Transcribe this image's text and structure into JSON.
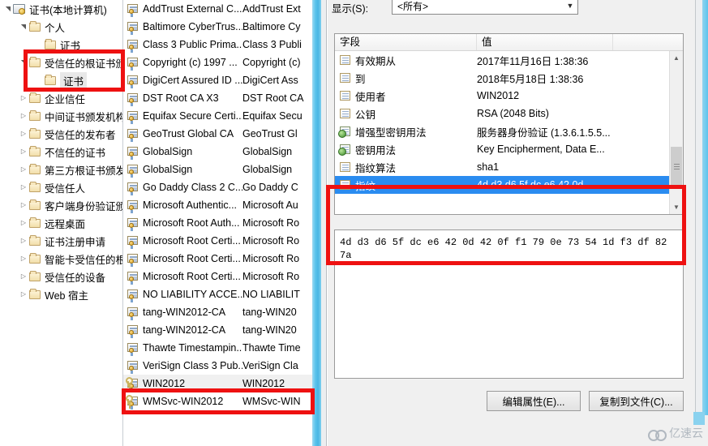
{
  "tree": {
    "items": [
      {
        "label": "证书(本地计算机)",
        "indent": 0,
        "twisty": "open",
        "icon": "console-root-icon"
      },
      {
        "label": "个人",
        "indent": 1,
        "twisty": "open",
        "icon": "folder-icon"
      },
      {
        "label": "证书",
        "indent": 2,
        "twisty": "none",
        "icon": "folder-icon"
      },
      {
        "label": "受信任的根证书颁发机构",
        "indent": 1,
        "twisty": "open",
        "icon": "folder-icon"
      },
      {
        "label": "证书",
        "indent": 2,
        "twisty": "none",
        "icon": "folder-icon",
        "selected": true
      },
      {
        "label": "企业信任",
        "indent": 1,
        "twisty": "closed",
        "icon": "folder-icon"
      },
      {
        "label": "中间证书颁发机构",
        "indent": 1,
        "twisty": "closed",
        "icon": "folder-icon"
      },
      {
        "label": "受信任的发布者",
        "indent": 1,
        "twisty": "closed",
        "icon": "folder-icon"
      },
      {
        "label": "不信任的证书",
        "indent": 1,
        "twisty": "closed",
        "icon": "folder-icon"
      },
      {
        "label": "第三方根证书颁发机构",
        "indent": 1,
        "twisty": "closed",
        "icon": "folder-icon"
      },
      {
        "label": "受信任人",
        "indent": 1,
        "twisty": "closed",
        "icon": "folder-icon"
      },
      {
        "label": "客户端身份验证颁发者",
        "indent": 1,
        "twisty": "closed",
        "icon": "folder-icon"
      },
      {
        "label": "远程桌面",
        "indent": 1,
        "twisty": "closed",
        "icon": "folder-icon"
      },
      {
        "label": "证书注册申请",
        "indent": 1,
        "twisty": "closed",
        "icon": "folder-icon"
      },
      {
        "label": "智能卡受信任的根",
        "indent": 1,
        "twisty": "closed",
        "icon": "folder-icon"
      },
      {
        "label": "受信任的设备",
        "indent": 1,
        "twisty": "closed",
        "icon": "folder-icon"
      },
      {
        "label": "Web 宿主",
        "indent": 1,
        "twisty": "closed",
        "icon": "folder-icon"
      }
    ]
  },
  "cert_list": {
    "rows": [
      {
        "col1": "AddTrust External C...",
        "col2": "AddTrust Ext",
        "icon": "certificate-icon"
      },
      {
        "col1": "Baltimore CyberTrus...",
        "col2": "Baltimore Cy",
        "icon": "certificate-icon"
      },
      {
        "col1": "Class 3 Public Prima...",
        "col2": "Class 3 Publi",
        "icon": "certificate-icon"
      },
      {
        "col1": "Copyright (c) 1997 ...",
        "col2": "Copyright (c)",
        "icon": "certificate-icon"
      },
      {
        "col1": "DigiCert Assured ID ...",
        "col2": "DigiCert Ass",
        "icon": "certificate-icon"
      },
      {
        "col1": "DST Root CA X3",
        "col2": "DST Root CA",
        "icon": "certificate-icon"
      },
      {
        "col1": "Equifax Secure Certi...",
        "col2": "Equifax Secu",
        "icon": "certificate-icon"
      },
      {
        "col1": "GeoTrust Global CA",
        "col2": "GeoTrust Gl",
        "icon": "certificate-icon"
      },
      {
        "col1": "GlobalSign",
        "col2": "GlobalSign",
        "icon": "certificate-icon"
      },
      {
        "col1": "GlobalSign",
        "col2": "GlobalSign",
        "icon": "certificate-icon"
      },
      {
        "col1": "Go Daddy Class 2 C...",
        "col2": "Go Daddy C",
        "icon": "certificate-icon"
      },
      {
        "col1": "Microsoft Authentic...",
        "col2": "Microsoft Au",
        "icon": "certificate-icon"
      },
      {
        "col1": "Microsoft Root Auth...",
        "col2": "Microsoft Ro",
        "icon": "certificate-icon"
      },
      {
        "col1": "Microsoft Root Certi...",
        "col2": "Microsoft Ro",
        "icon": "certificate-icon"
      },
      {
        "col1": "Microsoft Root Certi...",
        "col2": "Microsoft Ro",
        "icon": "certificate-icon"
      },
      {
        "col1": "Microsoft Root Certi...",
        "col2": "Microsoft Ro",
        "icon": "certificate-icon"
      },
      {
        "col1": "NO LIABILITY ACCE...",
        "col2": "NO LIABILIT",
        "icon": "certificate-icon"
      },
      {
        "col1": "tang-WIN2012-CA",
        "col2": "tang-WIN20",
        "icon": "certificate-icon"
      },
      {
        "col1": "tang-WIN2012-CA",
        "col2": "tang-WIN20",
        "icon": "certificate-icon"
      },
      {
        "col1": "Thawte Timestampin...",
        "col2": "Thawte Time",
        "icon": "certificate-icon"
      },
      {
        "col1": "VeriSign Class 3 Pub...",
        "col2": "VeriSign Cla",
        "icon": "certificate-icon"
      },
      {
        "col1": "WIN2012",
        "col2": "WIN2012",
        "icon": "certificate-key-icon",
        "selected": true
      },
      {
        "col1": "WMSvc-WIN2012",
        "col2": "WMSvc-WIN",
        "icon": "certificate-key-icon"
      }
    ]
  },
  "dialog": {
    "show_label": "显示(S):",
    "show_value": "<所有>",
    "dropdown_options": [
      "<所有>"
    ],
    "columns": {
      "field": "字段",
      "value": "值"
    },
    "fields": [
      {
        "name": "有效期从",
        "value": "2017年11月16日 1:38:36",
        "icon": "field-doc-icon"
      },
      {
        "name": "到",
        "value": "2018年5月18日 1:38:36",
        "icon": "field-doc-icon"
      },
      {
        "name": "使用者",
        "value": "WIN2012",
        "icon": "field-doc-icon"
      },
      {
        "name": "公钥",
        "value": "RSA (2048 Bits)",
        "icon": "field-doc-icon"
      },
      {
        "name": "增强型密钥用法",
        "value": "服务器身份验证 (1.3.6.1.5.5...",
        "icon": "field-ext-icon"
      },
      {
        "name": "密钥用法",
        "value": "Key Encipherment, Data E...",
        "icon": "field-ext-icon"
      },
      {
        "name": "指纹算法",
        "value": "sha1",
        "icon": "field-doc-icon"
      },
      {
        "name": "指纹",
        "value": "4d d3 d6 5f dc e6 42 0d ...",
        "icon": "field-doc-icon",
        "selected": true
      }
    ],
    "detail_text": "4d d3 d6 5f dc e6 42 0d 42 0f f1 79 0e 73 54 1d f3 df 82 7a",
    "buttons": {
      "edit_properties": "编辑属性(E)...",
      "copy_to_file": "复制到文件(C)..."
    },
    "scrollbar": {
      "up": "▲",
      "down": "▼"
    }
  },
  "annotations": {
    "color": "#ee1111",
    "boxes": [
      {
        "name": "trusted-root-certificates-highlight"
      },
      {
        "name": "win2012-certificate-row-highlight"
      },
      {
        "name": "thumbprint-value-highlight"
      }
    ]
  },
  "watermark": {
    "text": "亿速云",
    "icon": "cloud-icon"
  }
}
